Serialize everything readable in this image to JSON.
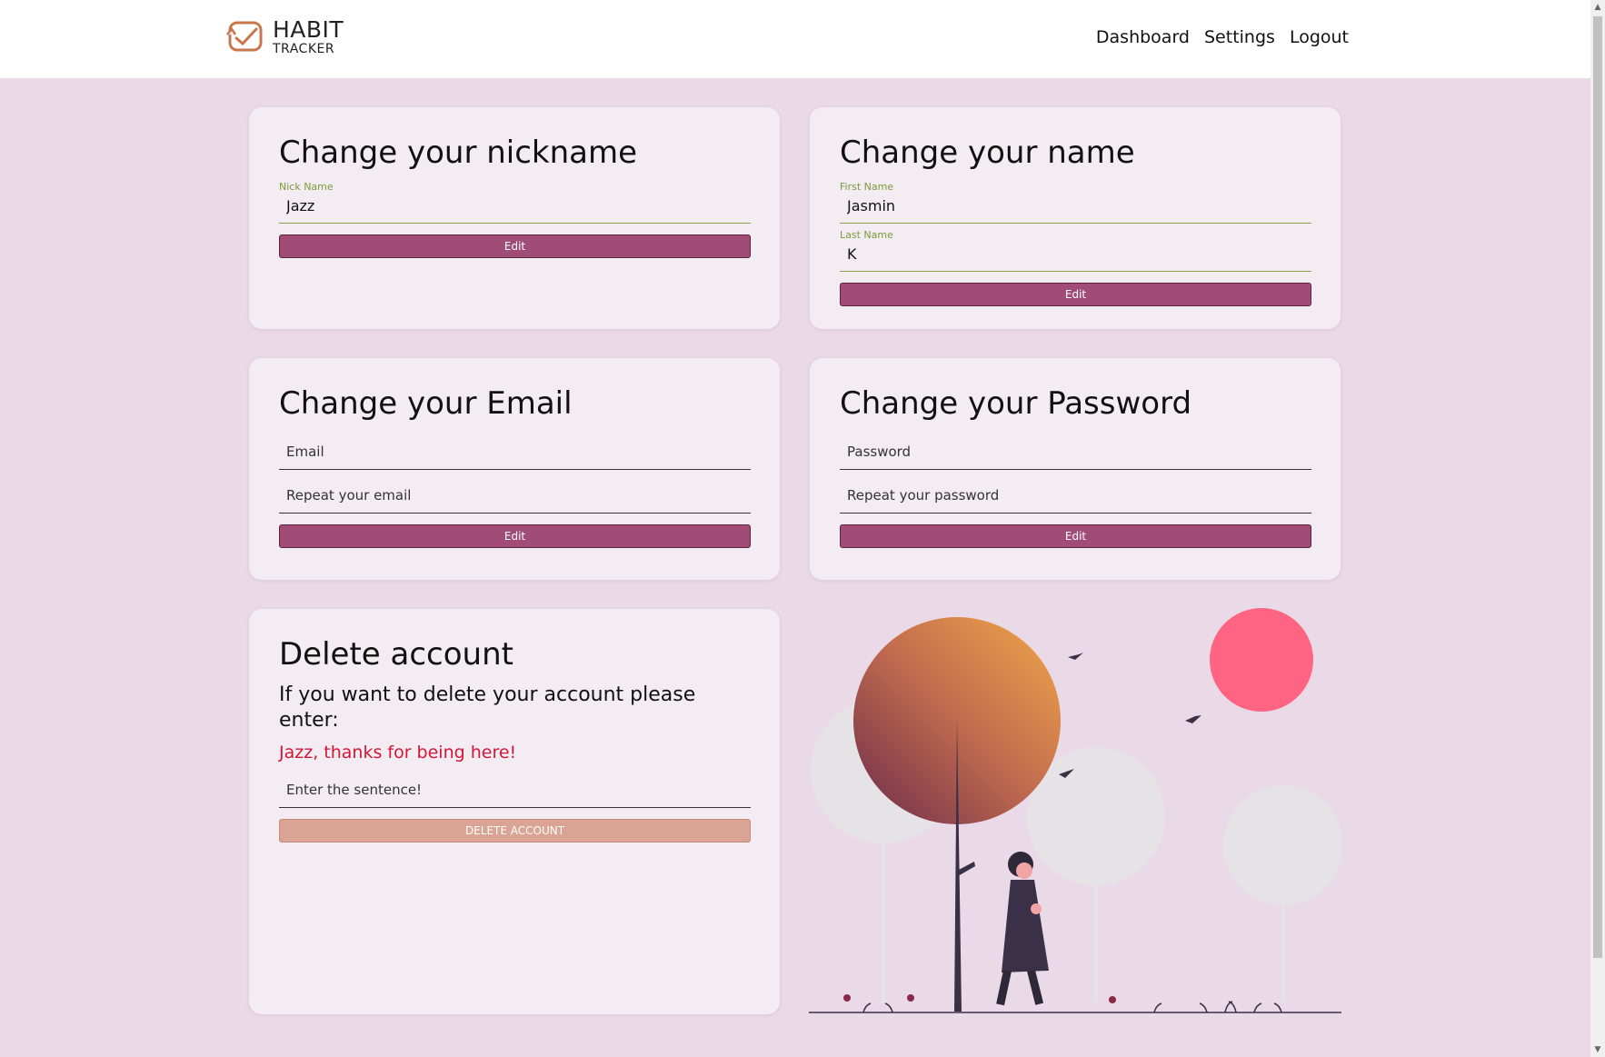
{
  "app": {
    "logo_line1": "HABIT",
    "logo_line2": "TRACKER"
  },
  "nav": {
    "dashboard": "Dashboard",
    "settings": "Settings",
    "logout": "Logout"
  },
  "nickname_card": {
    "title": "Change your nickname",
    "nick_label": "Nick Name",
    "nick_value": "Jazz",
    "button": "Edit"
  },
  "name_card": {
    "title": "Change your name",
    "first_label": "First Name",
    "first_value": "Jasmin",
    "last_label": "Last Name",
    "last_value": "K",
    "button": "Edit"
  },
  "email_card": {
    "title": "Change your Email",
    "email_placeholder": "Email",
    "repeat_placeholder": "Repeat your email",
    "button": "Edit"
  },
  "password_card": {
    "title": "Change your Password",
    "password_placeholder": "Password",
    "repeat_placeholder": "Repeat your password",
    "button": "Edit"
  },
  "delete_card": {
    "title": "Delete account",
    "instruction": "If you want to delete your account please enter:",
    "phrase": "Jazz, thanks for being here!",
    "input_placeholder": "Enter the sentence!",
    "button": "DELETE ACCOUNT"
  },
  "colors": {
    "page_bg": "#ead9e7",
    "card_bg": "#f4ecf3",
    "button": "#a04c76",
    "danger_button": "#d9a493",
    "phrase_red": "#d51635",
    "label_green": "#7a9a3a"
  },
  "icons": [
    "habit-tracker-logo-icon",
    "tree-icon",
    "sun-icon",
    "bird-icon",
    "walking-person-icon"
  ]
}
